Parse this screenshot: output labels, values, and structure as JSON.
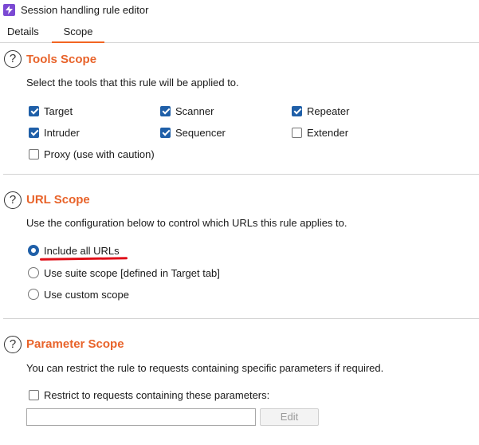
{
  "window": {
    "title": "Session handling rule editor"
  },
  "tabs": [
    {
      "label": "Details"
    },
    {
      "label": "Scope"
    }
  ],
  "colors": {
    "accent": "#e8632a",
    "checkbox": "#1f5fa8",
    "underline": "#e0101a"
  },
  "tools": {
    "title": "Tools Scope",
    "description": "Select the tools that this rule will be applied to.",
    "items": [
      {
        "label": "Target",
        "checked": true
      },
      {
        "label": "Scanner",
        "checked": true
      },
      {
        "label": "Repeater",
        "checked": true
      },
      {
        "label": "Intruder",
        "checked": true
      },
      {
        "label": "Sequencer",
        "checked": true
      },
      {
        "label": "Extender",
        "checked": false
      },
      {
        "label": "Proxy (use with caution)",
        "checked": false
      }
    ]
  },
  "url": {
    "title": "URL Scope",
    "description": "Use the configuration below to control which URLs this rule applies to.",
    "options": [
      {
        "label": "Include all URLs",
        "selected": true
      },
      {
        "label": "Use suite scope [defined in Target tab]",
        "selected": false
      },
      {
        "label": "Use custom scope",
        "selected": false
      }
    ]
  },
  "params": {
    "title": "Parameter Scope",
    "description": "You can restrict the rule to requests containing specific parameters if required.",
    "restrict_label": "Restrict to requests containing these parameters:",
    "restrict_checked": false,
    "input_value": "",
    "edit_label": "Edit"
  }
}
